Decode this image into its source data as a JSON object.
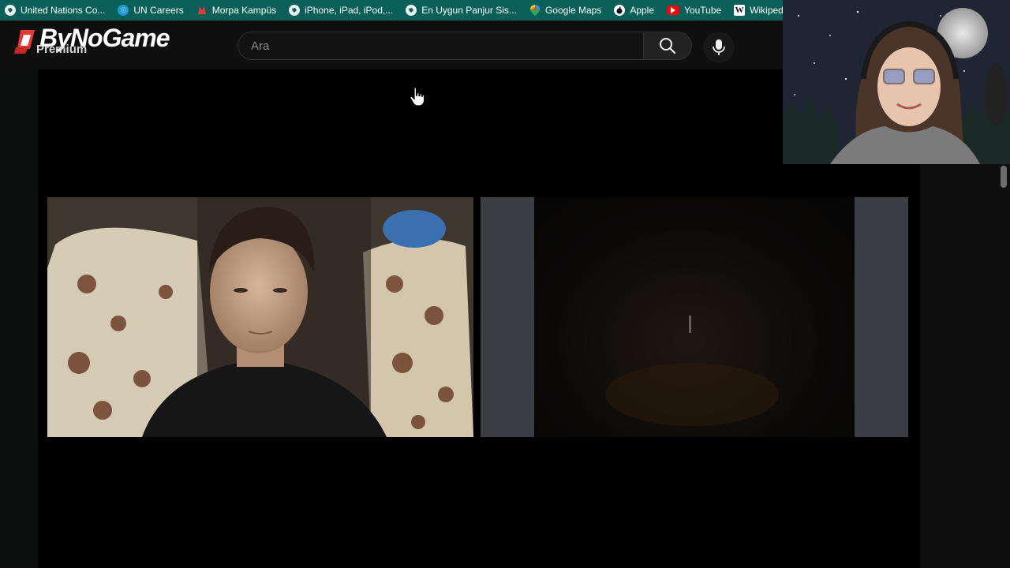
{
  "bookmarks": [
    {
      "label": "United Nations Co...",
      "icon": "globe-icon"
    },
    {
      "label": "UN Careers",
      "icon": "un-icon"
    },
    {
      "label": "Morpa Kampüs",
      "icon": "morpa-icon"
    },
    {
      "label": "iPhone, iPad, iPod,...",
      "icon": "globe-icon"
    },
    {
      "label": "En Uygun Panjur Sis...",
      "icon": "globe-icon"
    },
    {
      "label": "Google Maps",
      "icon": "maps-icon"
    },
    {
      "label": "Apple",
      "icon": "apple-icon"
    },
    {
      "label": "YouTube",
      "icon": "youtube-icon"
    },
    {
      "label": "Wikipedia",
      "icon": "wikipedia-icon"
    }
  ],
  "header": {
    "logo_title": "ByNoGame",
    "logo_sub": "Premium",
    "search_placeholder": "Ara"
  },
  "colors": {
    "bookmarks_bar": "#0b5f59",
    "page_background": "#0f0f0f",
    "video_area": "#000000",
    "logo_red": "#e53935"
  }
}
